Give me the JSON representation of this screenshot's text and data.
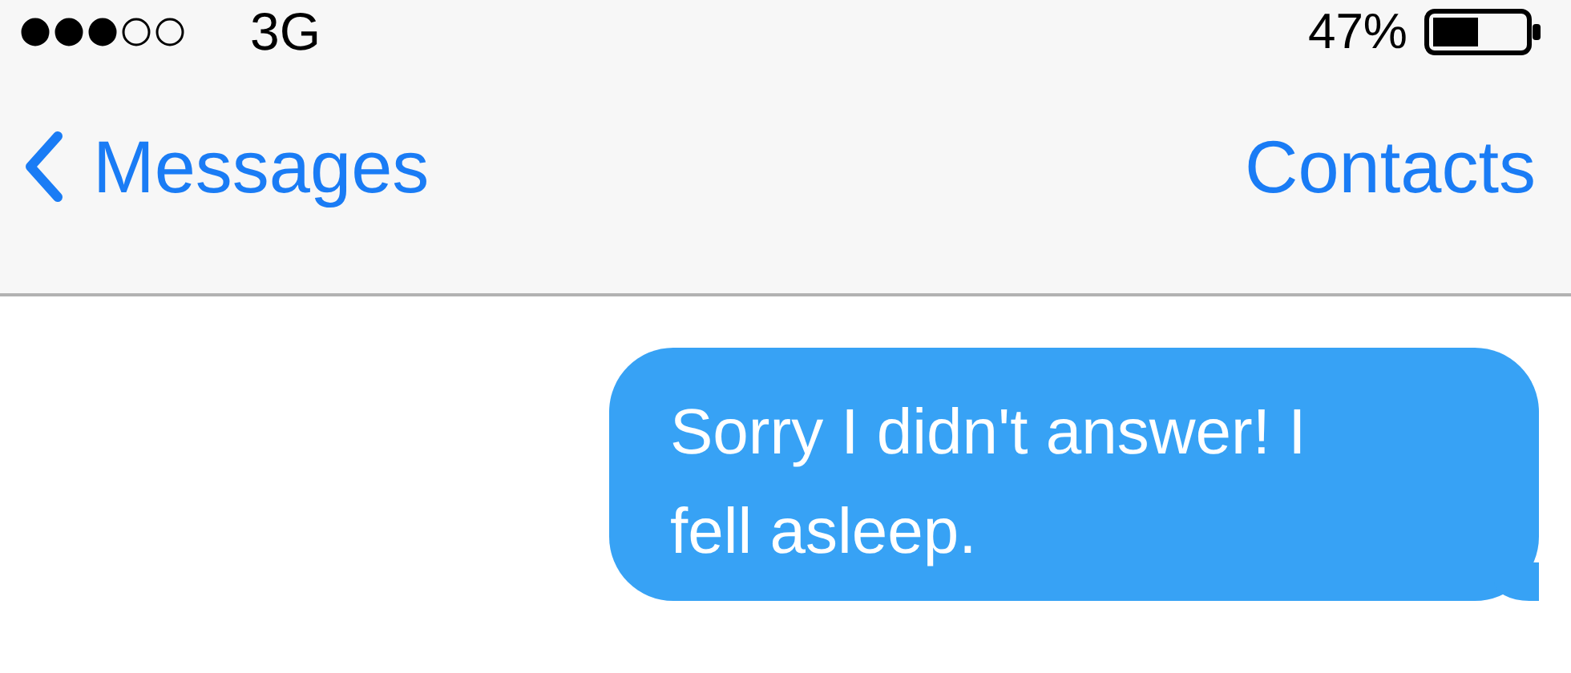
{
  "status_bar": {
    "network": "3G",
    "battery": "47%"
  },
  "nav_bar": {
    "back": "Messages",
    "action": "Contacts"
  },
  "messages": [
    {
      "kind": "sent",
      "text": "Sorry I didn't answer! I fell asleep."
    }
  ]
}
